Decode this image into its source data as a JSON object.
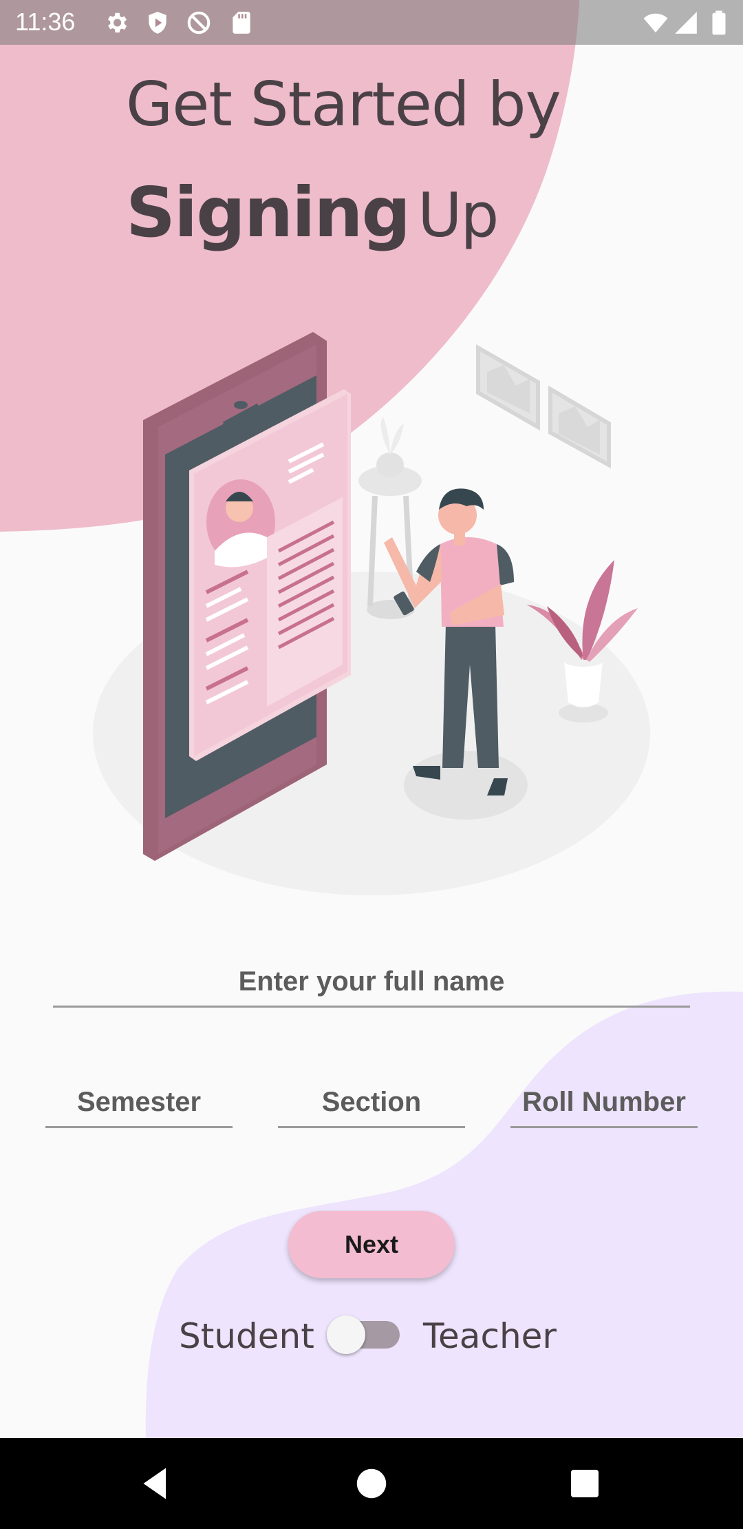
{
  "status_bar": {
    "time": "11:36",
    "icons": [
      "settings-icon",
      "shield-icon",
      "do-not-disturb-icon",
      "sd-card-icon",
      "wifi-icon",
      "signal-icon",
      "battery-icon"
    ]
  },
  "headline": {
    "line1": "Get Started by",
    "line2_bold": "Signing",
    "line2_light": "Up"
  },
  "form": {
    "full_name_placeholder": "Enter your full name",
    "semester_placeholder": "Semester",
    "section_placeholder": "Section",
    "roll_number_placeholder": "Roll Number"
  },
  "actions": {
    "next_label": "Next"
  },
  "role_toggle": {
    "left_label": "Student",
    "right_label": "Teacher",
    "is_teacher": false
  },
  "navigation": {
    "buttons": [
      "back-icon",
      "home-icon",
      "recents-icon"
    ]
  },
  "colors": {
    "accent_pink": "#f4bcd0",
    "blob_pink": "#efb9c8",
    "blob_lavender": "#eee4fd",
    "text_dark": "#4a4146"
  }
}
